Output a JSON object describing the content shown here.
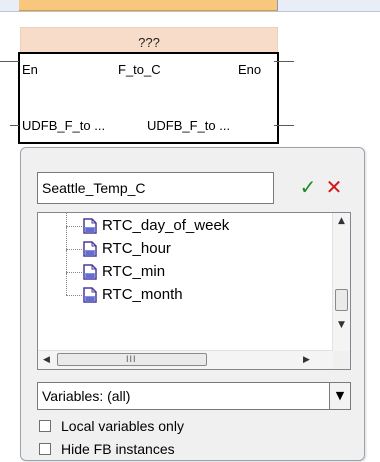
{
  "block": {
    "instance_name": "???",
    "pin_en": "En",
    "function_name": "F_to_C",
    "pin_eno": "Eno",
    "input_var": "UDFB_F_to ...",
    "output_var": "UDFB_F_to ..."
  },
  "dialog": {
    "name_value": "Seattle_Temp_C",
    "ok_icon": "checkmark-icon",
    "cancel_icon": "cross-icon",
    "colors": {
      "ok": "#1f8a2a",
      "cancel": "#d01818",
      "block_header": "#f7dcc9",
      "ruler_accent": "#f6c77c"
    },
    "variables": [
      {
        "label": "RTC_day_of_week",
        "icon": "document-icon"
      },
      {
        "label": "RTC_hour",
        "icon": "document-icon"
      },
      {
        "label": "RTC_min",
        "icon": "document-icon"
      },
      {
        "label": "RTC_month",
        "icon": "document-icon"
      }
    ],
    "hscroll_grip": "III",
    "filter_value": "Variables: (all)",
    "checkboxes": [
      {
        "label": "Local variables only",
        "checked": false
      },
      {
        "label": "Hide FB instances",
        "checked": false
      }
    ]
  }
}
